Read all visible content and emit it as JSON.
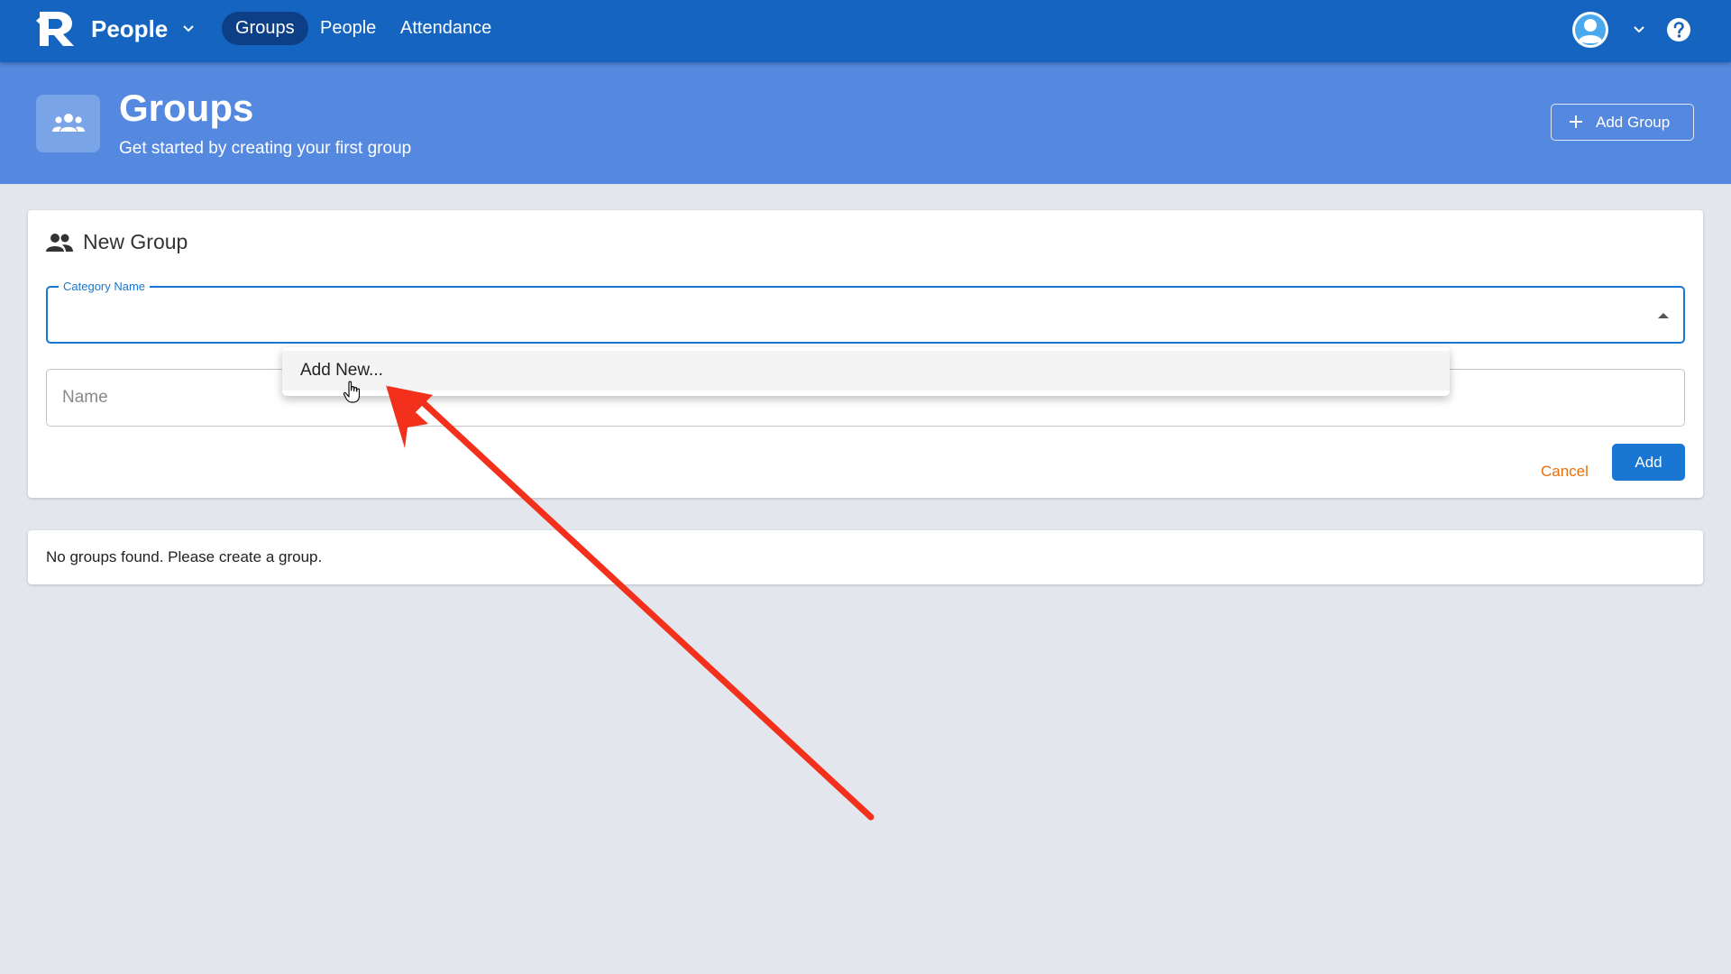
{
  "app": {
    "name": "People",
    "nav": [
      {
        "label": "Groups",
        "active": true
      },
      {
        "label": "People",
        "active": false
      },
      {
        "label": "Attendance",
        "active": false
      }
    ]
  },
  "header": {
    "title": "Groups",
    "subtitle": "Get started by creating your first group",
    "add_button": "Add Group",
    "icon": "groups-icon"
  },
  "new_group": {
    "title": "New Group",
    "icon": "group-icon",
    "category_label": "Category Name",
    "category_value": "",
    "name_placeholder": "Name",
    "cancel_label": "Cancel",
    "add_label": "Add"
  },
  "dropdown": {
    "items": [
      "Add New..."
    ]
  },
  "empty_state": {
    "text": "No groups found. Please create a group."
  },
  "colors": {
    "appbar": "#1565c0",
    "banner": "#5589df",
    "primary": "#1976d2",
    "cancel": "#e8700c",
    "annotation_arrow": "#f3301c",
    "background": "#e4e6ee"
  }
}
